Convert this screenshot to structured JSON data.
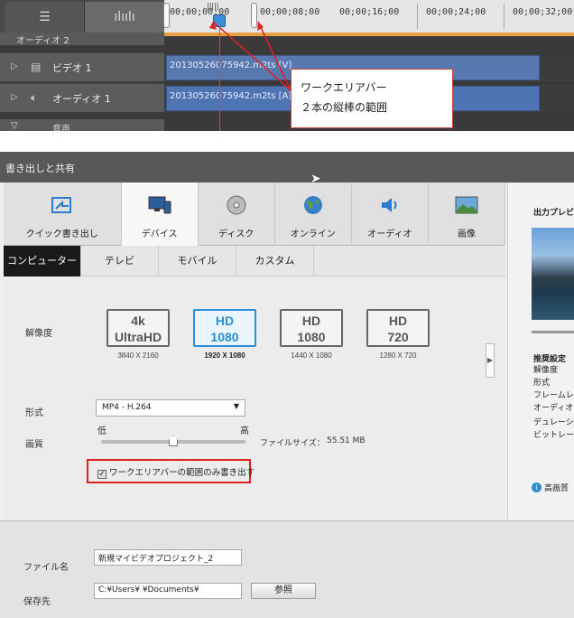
{
  "timeline": {
    "ruler_labels": [
      "00;00;00;00",
      "00;00;08;00",
      "00;00;16;00",
      "00;00;24;00",
      "00;00;32;00"
    ],
    "partial_track_label": "オーディオ 2",
    "tracks": [
      {
        "name": "ビデオ 1",
        "icon": "film-icon",
        "clip": "20130526075942.m2ts [V]"
      },
      {
        "name": "オーディオ 1",
        "icon": "speaker-icon",
        "clip": "20130526075942.m2ts [A]"
      }
    ],
    "last_track_label": "音声",
    "callout": {
      "line1": "ワークエリアバー",
      "line2": "２本の縦棒の範囲"
    },
    "colors": {
      "work_area": "#e8a040",
      "playhead": "#3a8fd8",
      "callout_border": "#cc4444"
    }
  },
  "dialog": {
    "title": "書き出しと共有",
    "categories": [
      {
        "label": "クイック書き出し",
        "icon": "quick-export-icon"
      },
      {
        "label": "デバイス",
        "icon": "device-icon",
        "active": true
      },
      {
        "label": "ディスク",
        "icon": "disc-icon"
      },
      {
        "label": "オンライン",
        "icon": "globe-icon"
      },
      {
        "label": "オーディオ",
        "icon": "speaker-icon"
      },
      {
        "label": "画像",
        "icon": "image-icon"
      }
    ],
    "subtabs": [
      "コンピューター",
      "テレビ",
      "モバイル",
      "カスタム"
    ],
    "active_subtab": "コンピューター",
    "resolution_label": "解像度",
    "resolutions": [
      {
        "line1": "4k",
        "line2": "UltraHD",
        "dims": "3840 X 2160"
      },
      {
        "line1": "HD",
        "line2": "1080",
        "dims": "1920 X 1080",
        "selected": true
      },
      {
        "line1": "HD",
        "line2": "1080",
        "dims": "1440 X 1080"
      },
      {
        "line1": "HD",
        "line2": "720",
        "dims": "1280 X 720"
      }
    ],
    "format_label": "形式",
    "format_value": "MP4 - H.264",
    "quality_label": "画質",
    "quality_low": "低",
    "quality_high": "高",
    "quality_level_percent": 50,
    "file_size_label": "ファイルサイズ：",
    "file_size_value": "55.51 MB",
    "work_area_checkbox_label": "ワークエリアバーの範囲のみ書き出す",
    "work_area_checked": true,
    "file_name_label": "ファイル名",
    "file_name_value": "新規マイビデオプロジェクト_2",
    "save_to_label": "保存先",
    "save_to_value": "C:¥Users¥          ¥Documents¥",
    "browse_label": "参照",
    "right_panel": {
      "title": "出力プレビュー",
      "items": [
        "推奨設定",
        "解像度",
        "形式",
        "フレームレート",
        "オーディオ",
        "デュレーション",
        "ビットレート"
      ],
      "hq_label": "高画質"
    }
  }
}
